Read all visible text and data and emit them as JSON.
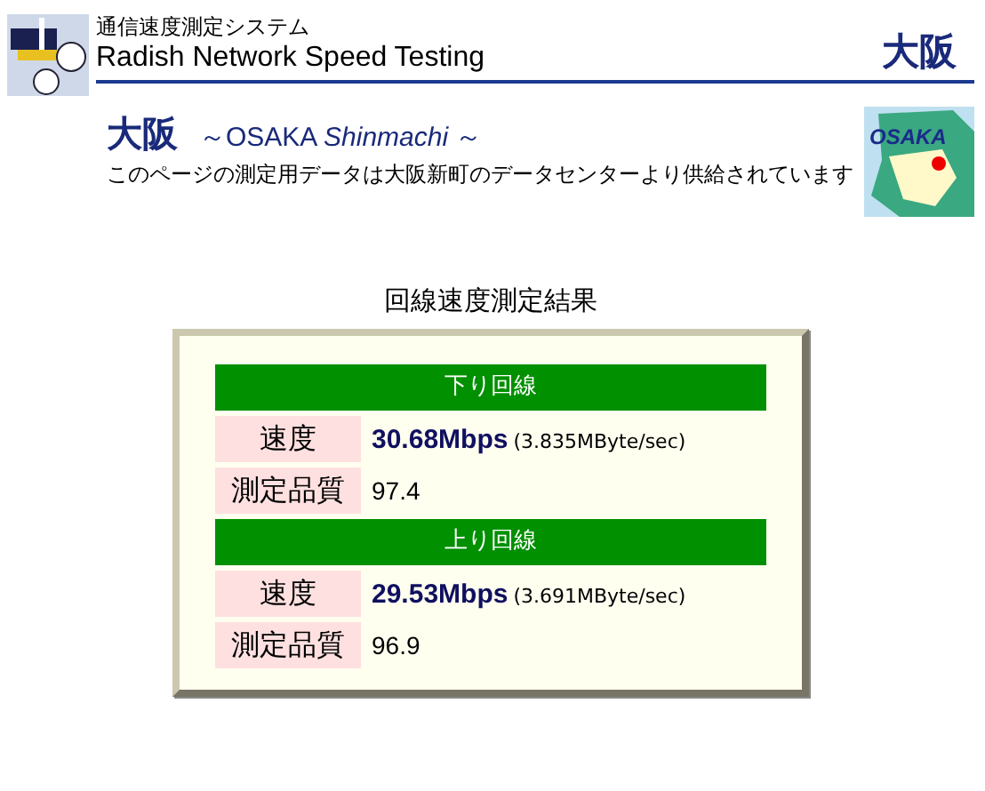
{
  "header": {
    "subtitle": "通信速度測定システム",
    "title": "Radish Network Speed Testing",
    "city": "大阪"
  },
  "location": {
    "city": "大阪",
    "tagline": "～OSAKA *Shinmachi* ～",
    "description": "このページの測定用データは大阪新町のデータセンターより供給されています",
    "map_label": "OSAKA"
  },
  "results": {
    "title": "回線速度測定結果",
    "sections": [
      {
        "heading": "下り回線",
        "rows": [
          {
            "kind": "speed",
            "label": "速度",
            "value": "30.68Mbps",
            "detail": "(3.835MByte/sec)"
          },
          {
            "kind": "quality",
            "label": "測定品質",
            "value": "97.4"
          }
        ]
      },
      {
        "heading": "上り回線",
        "rows": [
          {
            "kind": "speed",
            "label": "速度",
            "value": "29.53Mbps",
            "detail": "(3.691MByte/sec)"
          },
          {
            "kind": "quality",
            "label": "測定品質",
            "value": "96.9"
          }
        ]
      }
    ]
  }
}
